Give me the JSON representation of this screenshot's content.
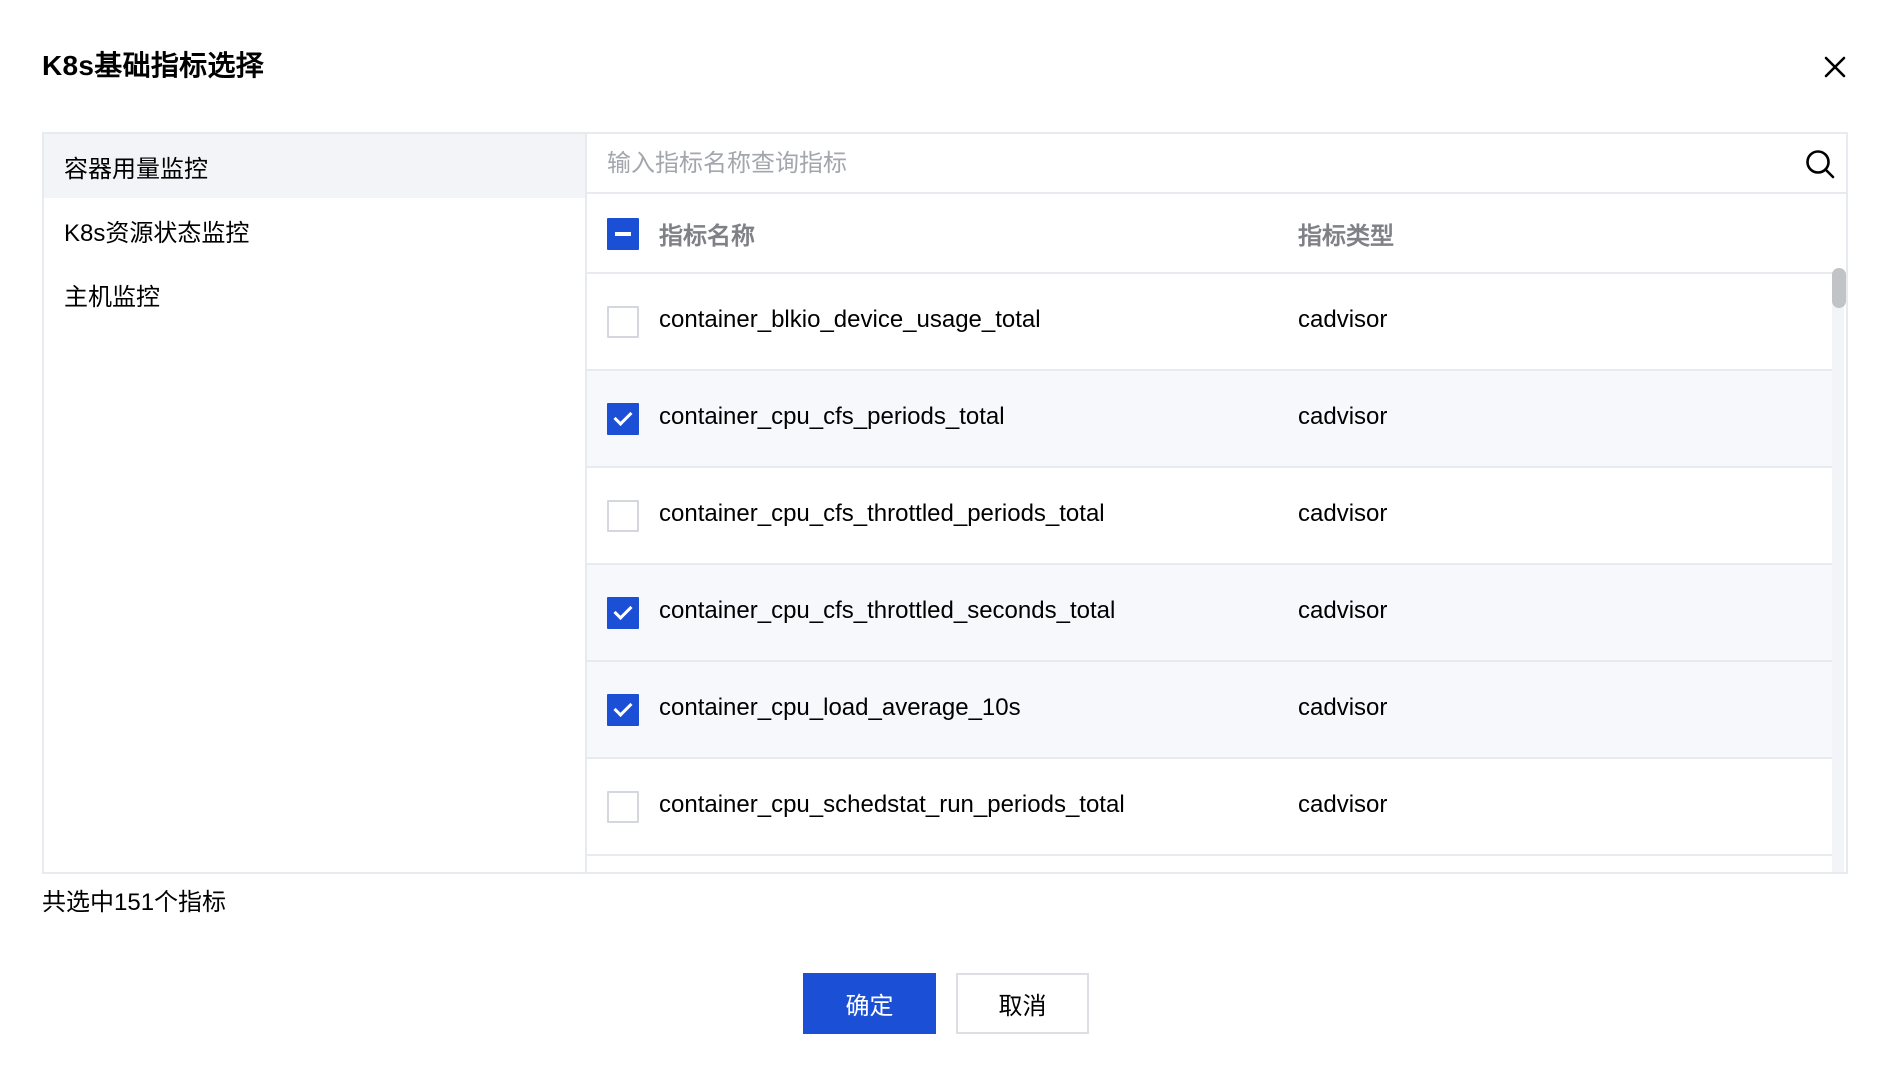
{
  "dialog": {
    "title": "K8s基础指标选择"
  },
  "categories": [
    {
      "label": "容器用量监控",
      "active": true
    },
    {
      "label": "K8s资源状态监控",
      "active": false
    },
    {
      "label": "主机监控",
      "active": false
    }
  ],
  "search": {
    "placeholder": "输入指标名称查询指标",
    "value": ""
  },
  "table": {
    "header_checkbox_state": "indeterminate",
    "columns": [
      "指标名称",
      "指标类型"
    ],
    "rows": [
      {
        "name": "container_blkio_device_usage_total",
        "type": "cadvisor",
        "checked": false
      },
      {
        "name": "container_cpu_cfs_periods_total",
        "type": "cadvisor",
        "checked": true
      },
      {
        "name": "container_cpu_cfs_throttled_periods_total",
        "type": "cadvisor",
        "checked": false
      },
      {
        "name": "container_cpu_cfs_throttled_seconds_total",
        "type": "cadvisor",
        "checked": true
      },
      {
        "name": "container_cpu_load_average_10s",
        "type": "cadvisor",
        "checked": true
      },
      {
        "name": "container_cpu_schedstat_run_periods_total",
        "type": "cadvisor",
        "checked": false
      }
    ]
  },
  "footer": {
    "selected_summary": "共选中151个指标",
    "confirm_label": "确定",
    "cancel_label": "取消"
  },
  "colors": {
    "primary": "#1a4fd6",
    "selected_row_bg": "#f6f8fb",
    "active_category_bg": "#f3f4f7",
    "border": "#e7eaef"
  },
  "icons": {
    "close": "close-icon",
    "search": "search-icon"
  }
}
